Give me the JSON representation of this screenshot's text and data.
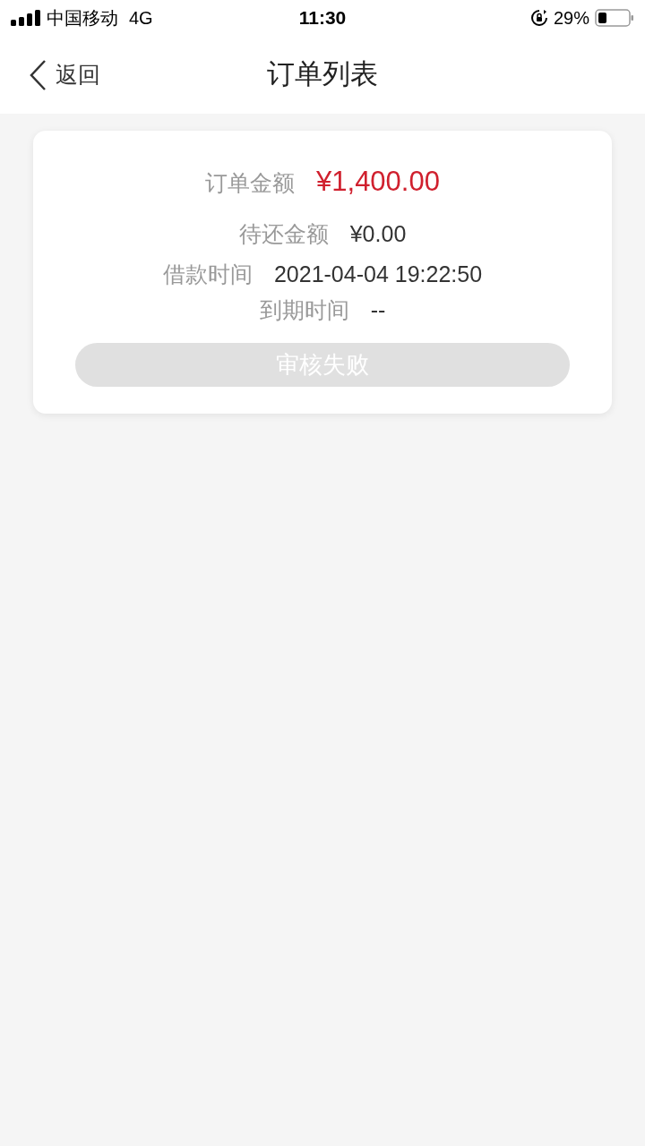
{
  "status_bar": {
    "carrier": "中国移动",
    "network": "4G",
    "time": "11:30",
    "battery": "29%"
  },
  "nav": {
    "back": "返回",
    "title": "订单列表"
  },
  "order": {
    "rows": [
      {
        "kind": "amount",
        "label": "订单金额",
        "value": "¥1,400.00"
      },
      {
        "kind": "plain",
        "label": "待还金额",
        "value": "¥0.00"
      },
      {
        "kind": "plain",
        "label": "借款时间",
        "value": "2021-04-04 19:22:50"
      },
      {
        "kind": "plain",
        "label": "到期时间",
        "value": "--"
      }
    ],
    "status_button": {
      "label": "审核失败",
      "disabled": true
    }
  }
}
